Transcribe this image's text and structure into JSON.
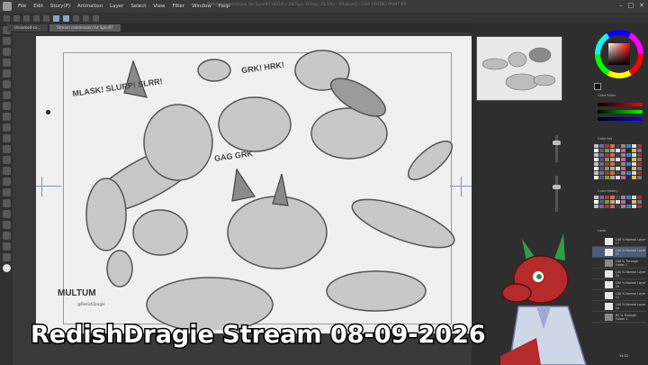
{
  "app": {
    "menu": [
      "File",
      "Edit",
      "Story(P)",
      "Animation",
      "Layer",
      "Select",
      "View",
      "Filter",
      "Window",
      "Help"
    ],
    "window_title": "Stream commission for Spini97 (4214 x 2875px 300dpi 35.1%) - [Multum] - CLIP STUDIO PAINT EX",
    "window_controls": [
      "–",
      "□",
      "✕"
    ]
  },
  "tabs": [
    {
      "label": "Unnamed-ce..."
    },
    {
      "label": "Stream commission for Spini97"
    }
  ],
  "artwork": {
    "captions": [
      "MLASK! SLURP! SLRR!",
      "GRK! HRK!",
      "GAG GRK"
    ],
    "signature": "MULTUM",
    "signature_handle": "@RedishDragie"
  },
  "panels": {
    "color_sub": "Color Slider",
    "color_set": "Color Set",
    "color_history": "Color History",
    "layer": "Layer",
    "layers": [
      {
        "label": "100 % Normal Layer 17"
      },
      {
        "label": "100 % Normal Layer 22"
      },
      {
        "label": "100 % Through Folder 2"
      },
      {
        "label": "100 % Normal Layer 20"
      },
      {
        "label": "100 % Normal Layer 19"
      },
      {
        "label": "100 % Normal Layer 11"
      },
      {
        "label": "100 % Normal Layer 10"
      },
      {
        "label": "65 % Through Folder 1"
      }
    ]
  },
  "colors": {
    "accent_layer": "#4c5d78",
    "wheel_ring": "#ff0000"
  },
  "overlay": {
    "title": "RedishDragie Stream 08-09-2026"
  }
}
